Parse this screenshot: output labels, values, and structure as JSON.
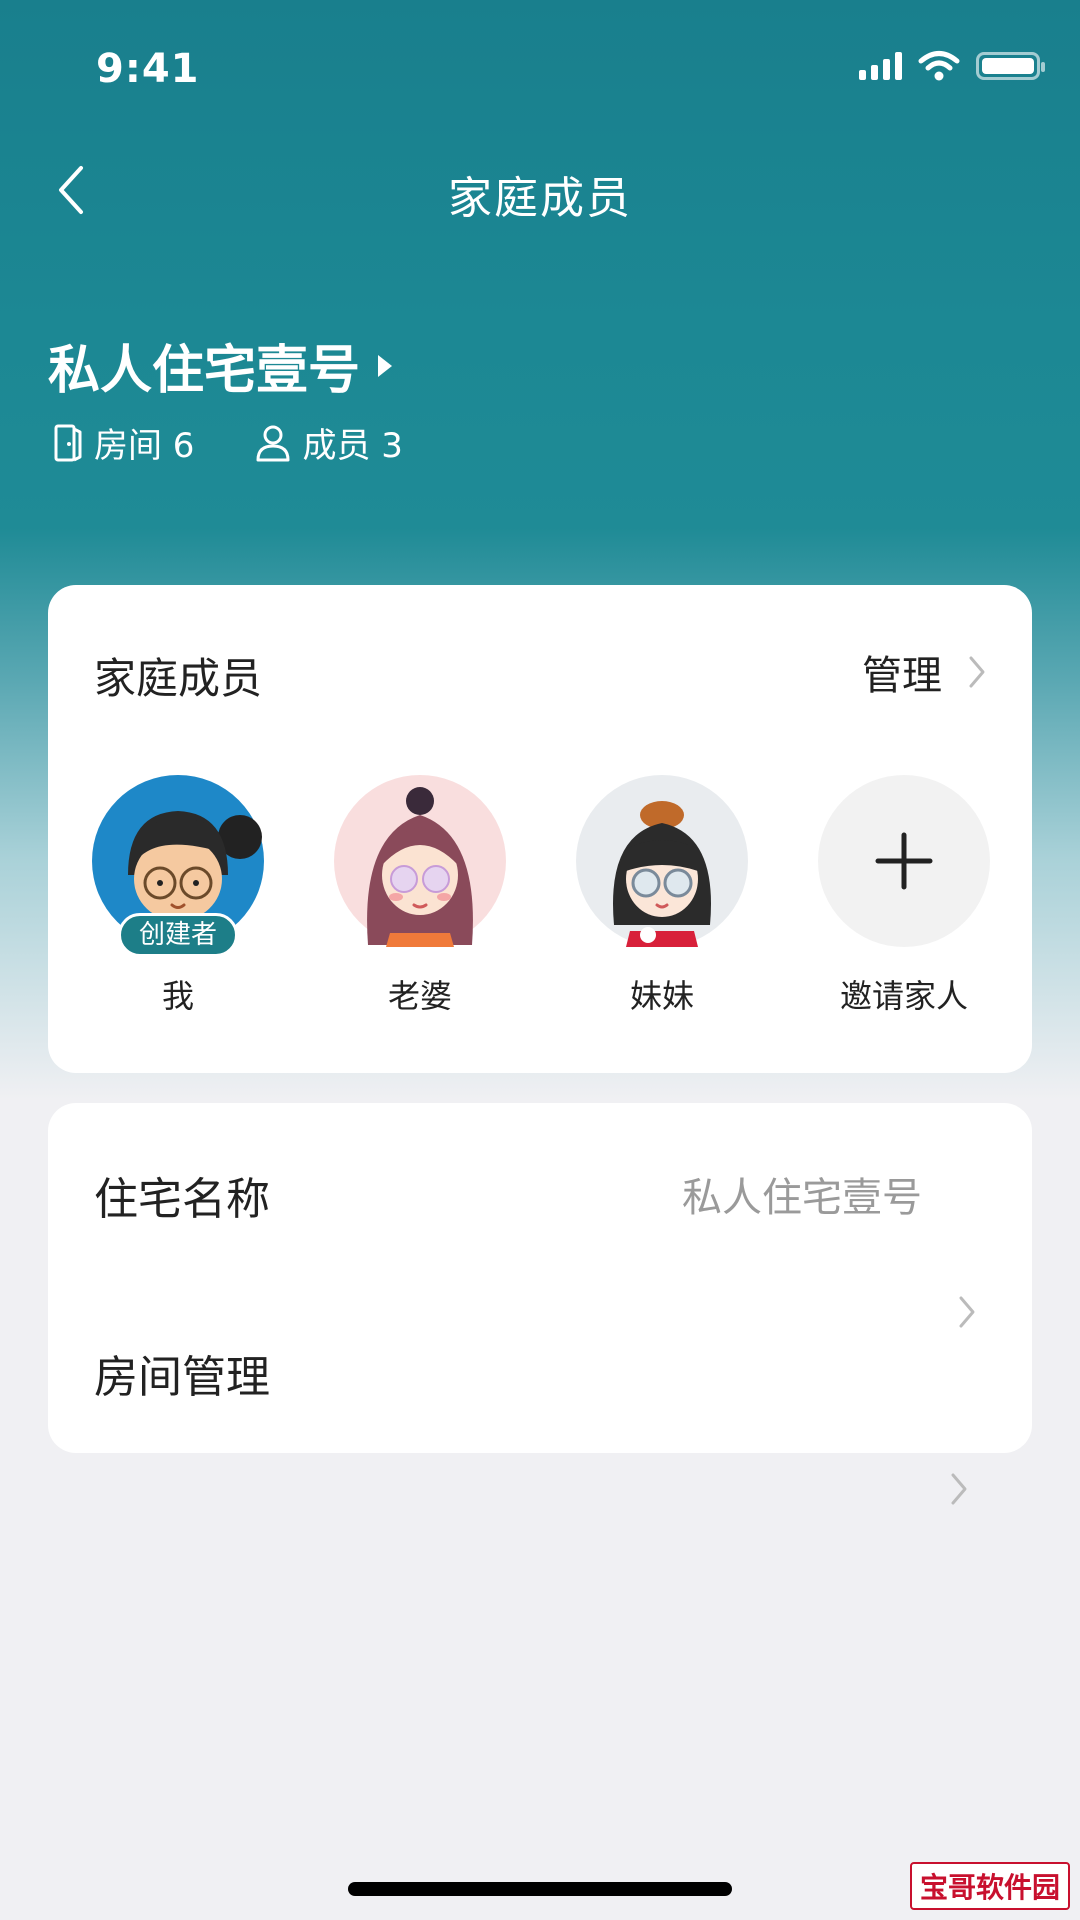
{
  "status_bar": {
    "time": "9:41"
  },
  "nav": {
    "title": "家庭成员"
  },
  "home": {
    "name": "私人住宅壹号",
    "rooms_label": "房间 6",
    "members_label": "成员 3"
  },
  "members_card": {
    "title": "家庭成员",
    "manage_label": "管理",
    "members": [
      {
        "name": "我",
        "badge": "创建者"
      },
      {
        "name": "老婆"
      },
      {
        "name": "妹妹"
      }
    ],
    "invite_label": "邀请家人"
  },
  "settings_card": {
    "home_name_label": "住宅名称",
    "home_name_value": "私人住宅壹号",
    "room_manage_label": "房间管理"
  },
  "watermark": "宝哥软件园"
}
